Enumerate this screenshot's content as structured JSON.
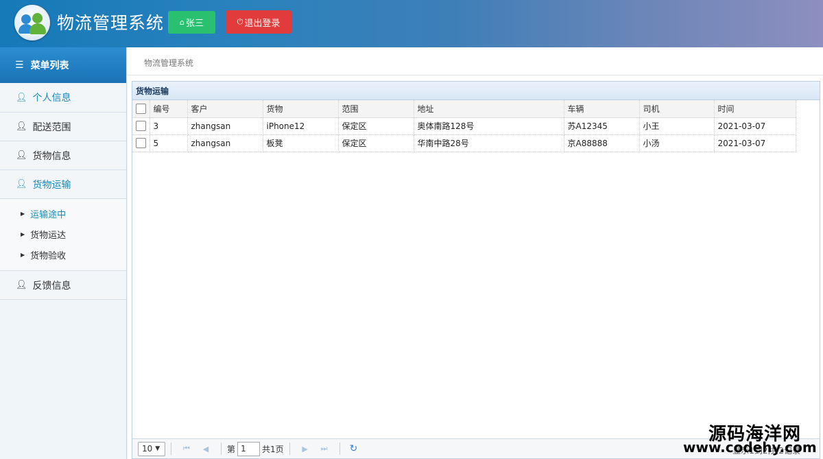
{
  "header": {
    "title": "物流管理系统",
    "user_label": "张三",
    "logout_label": "退出登录"
  },
  "sidebar": {
    "heading": "菜单列表",
    "items": [
      {
        "label": "个人信息"
      },
      {
        "label": "配送范围"
      },
      {
        "label": "货物信息"
      },
      {
        "label": "货物运输"
      },
      {
        "label": "反馈信息"
      }
    ],
    "submenu": [
      {
        "label": "运输途中"
      },
      {
        "label": "货物运达"
      },
      {
        "label": "货物验收"
      }
    ]
  },
  "main": {
    "breadcrumb": "物流管理系统",
    "panel_title": "货物运输",
    "columns": [
      "编号",
      "客户",
      "货物",
      "范围",
      "地址",
      "车辆",
      "司机",
      "时间"
    ],
    "rows": [
      [
        "3",
        "zhangsan",
        "iPhone12",
        "保定区",
        "奥体南路128号",
        "苏A12345",
        "小王",
        "2021-03-07"
      ],
      [
        "5",
        "zhangsan",
        "板凳",
        "保定区",
        "华南中路28号",
        "京A88888",
        "小汤",
        "2021-03-07"
      ]
    ]
  },
  "pager": {
    "page_size": "10",
    "page_prefix": "第",
    "page_value": "1",
    "page_suffix": "共1页",
    "info": "显示1到2,共2记录"
  },
  "watermark": {
    "line1": "源码海洋网",
    "line2": "www.codehy.com"
  },
  "colors": {
    "accent": "#1a8ab5",
    "user_button": "#29c16f",
    "logout_button": "#e23b3b"
  }
}
